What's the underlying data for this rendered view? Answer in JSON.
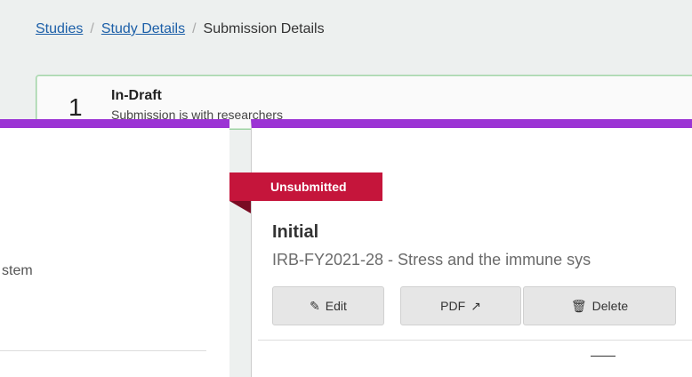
{
  "breadcrumb": {
    "items": [
      "Studies",
      "Study Details",
      "Submission Details"
    ],
    "separator": "/"
  },
  "status": {
    "step_number": "1",
    "title": "In-Draft",
    "subtitle": "Submission is with researchers"
  },
  "left_panel": {
    "text": "stem"
  },
  "submission": {
    "badge": "Unsubmitted",
    "title": "Initial",
    "description": "IRB-FY2021-28 - Stress and the immune sys"
  },
  "actions": {
    "edit_label": "Edit",
    "pdf_label": "PDF",
    "delete_label": "Delete"
  },
  "colors": {
    "accent_purple": "#9b34d4",
    "ribbon_red": "#c5153b",
    "link_blue": "#1c5fa8"
  },
  "icons": {
    "edit": "pencil-icon",
    "pdf": "pdf-icon",
    "external": "external-link-icon",
    "delete": "trash-icon"
  }
}
